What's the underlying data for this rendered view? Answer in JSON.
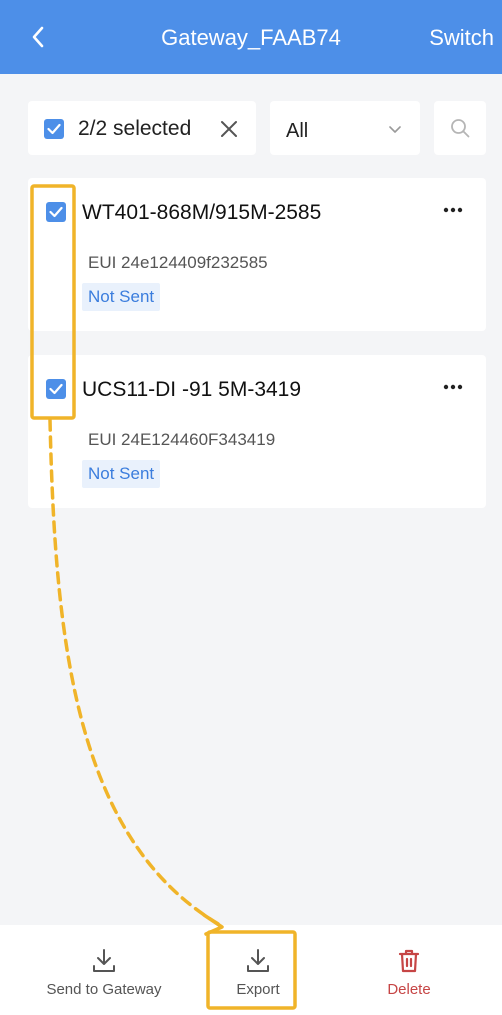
{
  "header": {
    "title": "Gateway_FAAB74",
    "switch_label": "Switch"
  },
  "selection": {
    "count_label": "2/2 selected",
    "all_checked": true
  },
  "filter": {
    "selected": "All"
  },
  "devices": [
    {
      "name": "WT401-868M/915M-2585",
      "eui": "EUI 24e124409f232585",
      "status": "Not Sent",
      "checked": true
    },
    {
      "name": "UCS11-DI -91 5M-3419",
      "eui": "EUI 24E124460F343419",
      "status": "Not Sent",
      "checked": true
    }
  ],
  "bottom_actions": [
    {
      "label": "Send to Gateway",
      "icon": "download-icon"
    },
    {
      "label": "Export",
      "icon": "download-icon"
    },
    {
      "label": "Delete",
      "icon": "trash-icon"
    }
  ],
  "colors": {
    "primary": "#4d8fe8",
    "highlight": "#f0b429",
    "danger": "#c64545",
    "status_bg": "#e9f1fc",
    "status_text": "#3b7ddd"
  }
}
